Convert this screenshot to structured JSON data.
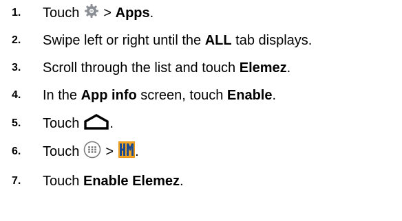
{
  "steps": [
    {
      "number": "1.",
      "parts": {
        "t1": "Touch",
        "icon": "settings-gear-icon",
        "t2": ">",
        "b1": "Apps",
        "t3": "."
      }
    },
    {
      "number": "2.",
      "parts": {
        "t1": "Swipe left or right until the",
        "b1": "ALL",
        "t2": "tab displays."
      }
    },
    {
      "number": "3.",
      "parts": {
        "t1": "Scroll through the list and touch",
        "b1": "Elemez",
        "t2": "."
      }
    },
    {
      "number": "4.",
      "parts": {
        "t1": "In the",
        "b1": "App info",
        "t2": "screen, touch",
        "b2": "Enable",
        "t3": "."
      }
    },
    {
      "number": "5.",
      "parts": {
        "t1": "Touch",
        "icon": "home-icon",
        "t2": "."
      }
    },
    {
      "number": "6.",
      "parts": {
        "t1": "Touch",
        "icon1": "all-apps-icon",
        "t2": ">",
        "icon2": "elemez-app-icon",
        "t3": "."
      }
    },
    {
      "number": "7.",
      "parts": {
        "t1": "Touch",
        "b1": "Enable Elemez",
        "t2": "."
      }
    }
  ],
  "colors": {
    "text": "#000000",
    "gear": "#8a8f95",
    "apps_icon_ring": "#7a7a7a",
    "elemez_bg": "#f5a623",
    "elemez_fg": "#1c4a8c"
  }
}
